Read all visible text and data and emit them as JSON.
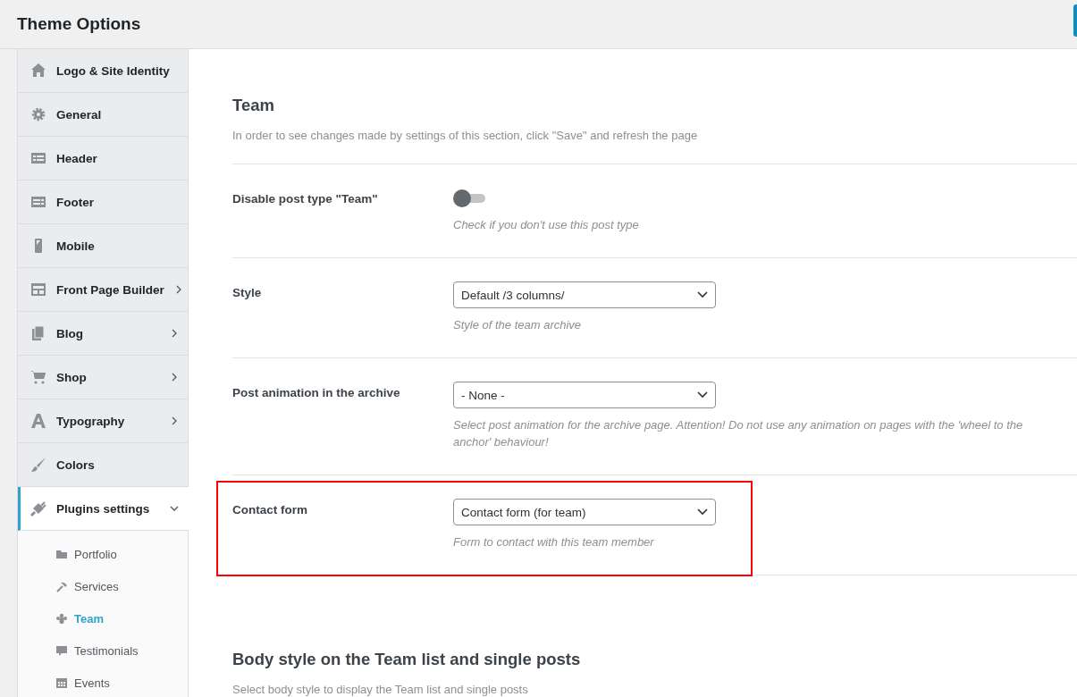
{
  "page": {
    "title": "Theme Options"
  },
  "sidebar": {
    "items": [
      {
        "label": "Logo & Site Identity",
        "expandable": false,
        "selected": false
      },
      {
        "label": "General",
        "expandable": false,
        "selected": false
      },
      {
        "label": "Header",
        "expandable": false,
        "selected": false
      },
      {
        "label": "Footer",
        "expandable": false,
        "selected": false
      },
      {
        "label": "Mobile",
        "expandable": false,
        "selected": false
      },
      {
        "label": "Front Page Builder",
        "expandable": true,
        "selected": false
      },
      {
        "label": "Blog",
        "expandable": true,
        "selected": false
      },
      {
        "label": "Shop",
        "expandable": true,
        "selected": false
      },
      {
        "label": "Typography",
        "expandable": true,
        "selected": false
      },
      {
        "label": "Colors",
        "expandable": false,
        "selected": false
      },
      {
        "label": "Plugins settings",
        "expandable": true,
        "selected": true,
        "expanded": true,
        "children": [
          {
            "label": "Portfolio",
            "selected": false
          },
          {
            "label": "Services",
            "selected": false
          },
          {
            "label": "Team",
            "selected": true
          },
          {
            "label": "Testimonials",
            "selected": false
          },
          {
            "label": "Events",
            "selected": false
          }
        ]
      }
    ]
  },
  "section": {
    "title": "Team",
    "description": "In order to see changes made by settings of this section, click \"Save\" and refresh the page"
  },
  "settings": [
    {
      "kind": "toggle",
      "label": "Disable post type \"Team\"",
      "on": false,
      "help": "Check if you don't use this post type",
      "highlighted": false
    },
    {
      "kind": "select",
      "label": "Style",
      "value": "Default /3 columns/",
      "help": "Style of the team archive",
      "highlighted": false
    },
    {
      "kind": "select",
      "label": "Post animation in the archive",
      "value": "- None -",
      "help": "Select post animation for the archive page. Attention! Do not use any animation on pages with the 'wheel to the anchor' behaviour!",
      "highlighted": false
    },
    {
      "kind": "select",
      "label": "Contact form",
      "value": "Contact form (for team)",
      "help": "Form to contact with this team member",
      "highlighted": true
    }
  ],
  "next_section": {
    "title": "Body style on the Team list and single posts",
    "description": "Select body style to display the Team list and single posts"
  }
}
